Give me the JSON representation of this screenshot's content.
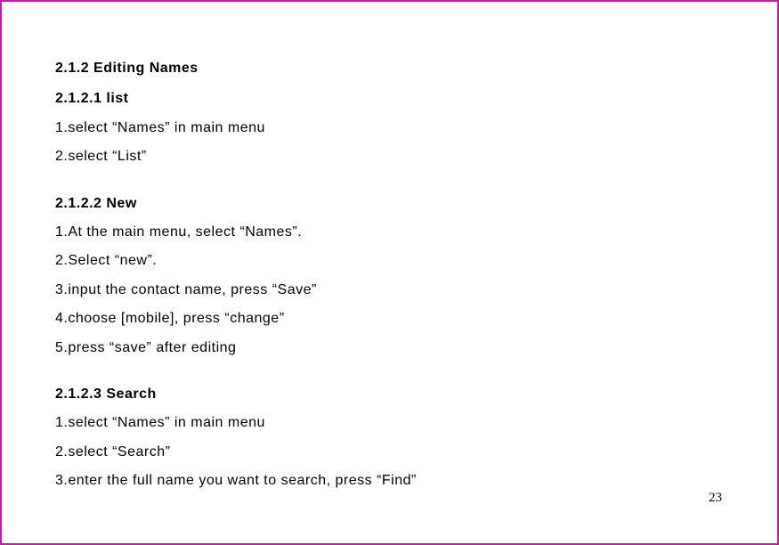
{
  "page_number": "23",
  "sections": {
    "main_heading": "2.1.2 Editing Names",
    "list": {
      "heading": "2.1.2.1 list",
      "steps": {
        "s1": "1.select “Names” in main menu",
        "s2": "2.select “List”"
      }
    },
    "new": {
      "heading": "2.1.2.2 New",
      "steps": {
        "s1": "1.At the main menu, select “Names”.",
        "s2": "2.Select “new”.",
        "s3": "3.input the contact name, press “Save”",
        "s4": "4.choose [mobile], press “change”",
        "s5": "5.press “save” after editing"
      }
    },
    "search": {
      "heading": "2.1.2.3 Search",
      "steps": {
        "s1": "1.select “Names” in main menu",
        "s2": "2.select “Search”",
        "s3": "3.enter the full name you want to search, press “Find”"
      }
    }
  }
}
